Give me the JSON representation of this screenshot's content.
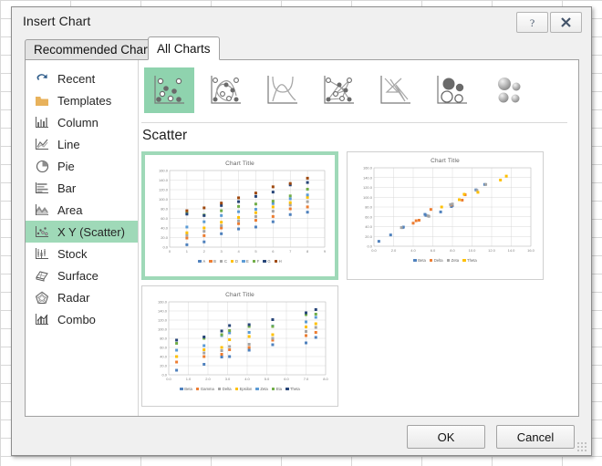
{
  "window": {
    "title": "Insert Chart",
    "help_icon": "question-mark-icon",
    "close_icon": "close-icon"
  },
  "tabs": [
    {
      "label": "Recommended Charts",
      "active": false
    },
    {
      "label": "All Charts",
      "active": true
    }
  ],
  "sidebar": {
    "items": [
      {
        "label": "Recent",
        "icon": "recent-undo-icon",
        "selected": false
      },
      {
        "label": "Templates",
        "icon": "folder-icon",
        "selected": false
      },
      {
        "label": "Column",
        "icon": "column-chart-icon",
        "selected": false
      },
      {
        "label": "Line",
        "icon": "line-chart-icon",
        "selected": false
      },
      {
        "label": "Pie",
        "icon": "pie-chart-icon",
        "selected": false
      },
      {
        "label": "Bar",
        "icon": "bar-chart-icon",
        "selected": false
      },
      {
        "label": "Area",
        "icon": "area-chart-icon",
        "selected": false
      },
      {
        "label": "X Y (Scatter)",
        "icon": "scatter-chart-icon",
        "selected": true
      },
      {
        "label": "Stock",
        "icon": "stock-chart-icon",
        "selected": false
      },
      {
        "label": "Surface",
        "icon": "surface-chart-icon",
        "selected": false
      },
      {
        "label": "Radar",
        "icon": "radar-chart-icon",
        "selected": false
      },
      {
        "label": "Combo",
        "icon": "combo-chart-icon",
        "selected": false
      }
    ]
  },
  "main": {
    "section_title": "Scatter",
    "subtypes": [
      {
        "name": "scatter-markers-only",
        "selected": true
      },
      {
        "name": "scatter-smooth-lines-markers",
        "selected": false
      },
      {
        "name": "scatter-smooth-lines",
        "selected": false
      },
      {
        "name": "scatter-straight-lines-markers",
        "selected": false
      },
      {
        "name": "scatter-straight-lines",
        "selected": false
      },
      {
        "name": "bubble",
        "selected": false
      },
      {
        "name": "bubble-3d",
        "selected": false
      }
    ],
    "selection_color": "#9fd9b8"
  },
  "footer": {
    "ok_label": "OK",
    "cancel_label": "Cancel"
  },
  "chart_data": [
    {
      "id": "preview-1",
      "type": "scatter",
      "title": "Chart Title",
      "selected": true,
      "xlabel": "",
      "ylabel": "",
      "xlim": [
        0,
        9
      ],
      "ylim": [
        0,
        160
      ],
      "xticks": [
        0,
        1,
        2,
        3,
        4,
        5,
        6,
        7,
        8,
        9
      ],
      "yticks": [
        "0.0",
        "20.0",
        "40.0",
        "60.0",
        "80.0",
        "100.0",
        "120.0",
        "140.0",
        "160.0"
      ],
      "grid": true,
      "legend_position": "bottom",
      "series": [
        {
          "name": "A",
          "color": "#4f81bd",
          "points": [
            [
              1,
              5
            ],
            [
              2,
              11
            ],
            [
              3,
              28
            ],
            [
              4,
              38
            ],
            [
              5,
              42
            ],
            [
              6,
              53
            ],
            [
              7,
              68
            ],
            [
              8,
              73
            ]
          ]
        },
        {
          "name": "B",
          "color": "#ed7d31",
          "points": [
            [
              1,
              19
            ],
            [
              2,
              24
            ],
            [
              3,
              40
            ],
            [
              4,
              49
            ],
            [
              5,
              56
            ],
            [
              6,
              64
            ],
            [
              7,
              80
            ],
            [
              8,
              84
            ]
          ]
        },
        {
          "name": "C",
          "color": "#a5a5a5",
          "points": [
            [
              1,
              25
            ],
            [
              2,
              33
            ],
            [
              3,
              45
            ],
            [
              4,
              55
            ],
            [
              5,
              64
            ],
            [
              6,
              75
            ],
            [
              7,
              88
            ],
            [
              8,
              95
            ]
          ]
        },
        {
          "name": "D",
          "color": "#ffc000",
          "points": [
            [
              1,
              30
            ],
            [
              2,
              40
            ],
            [
              3,
              52
            ],
            [
              4,
              62
            ],
            [
              5,
              72
            ],
            [
              6,
              84
            ],
            [
              7,
              93
            ],
            [
              8,
              104
            ]
          ]
        },
        {
          "name": "E",
          "color": "#5b9bd5",
          "points": [
            [
              1,
              42
            ],
            [
              2,
              53
            ],
            [
              3,
              66
            ],
            [
              4,
              74
            ],
            [
              5,
              79
            ],
            [
              6,
              91
            ],
            [
              7,
              101
            ],
            [
              8,
              109
            ]
          ]
        },
        {
          "name": "F",
          "color": "#70ad47",
          "points": [
            [
              1,
              72
            ],
            [
              2,
              67
            ],
            [
              3,
              76
            ],
            [
              4,
              85
            ],
            [
              5,
              90
            ],
            [
              6,
              96
            ],
            [
              7,
              107
            ],
            [
              8,
              121
            ]
          ]
        },
        {
          "name": "G",
          "color": "#264478",
          "points": [
            [
              1,
              69
            ],
            [
              2,
              66
            ],
            [
              3,
              87
            ],
            [
              4,
              95
            ],
            [
              5,
              106
            ],
            [
              6,
              115
            ],
            [
              7,
              130
            ],
            [
              8,
              135
            ]
          ]
        },
        {
          "name": "H",
          "color": "#9e480e",
          "points": [
            [
              1,
              76
            ],
            [
              2,
              82
            ],
            [
              3,
              92
            ],
            [
              4,
              103
            ],
            [
              5,
              113
            ],
            [
              6,
              126
            ],
            [
              7,
              133
            ],
            [
              8,
              144
            ]
          ]
        }
      ]
    },
    {
      "id": "preview-2",
      "type": "scatter",
      "title": "Chart Title",
      "selected": false,
      "xlabel": "",
      "ylabel": "",
      "xlim": [
        0,
        16
      ],
      "ylim": [
        0,
        160
      ],
      "xticks": [
        "0.0",
        "2.0",
        "4.0",
        "6.0",
        "8.0",
        "10.0",
        "12.0",
        "14.0",
        "16.0"
      ],
      "yticks": [
        "0.0",
        "20.0",
        "40.0",
        "60.0",
        "80.0",
        "100.0",
        "120.0",
        "140.0",
        "160.0"
      ],
      "grid": true,
      "legend_position": "bottom",
      "series": [
        {
          "name": "Beta",
          "color": "#4f81bd",
          "points": [
            [
              0.5,
              10
            ],
            [
              1.7,
              23
            ],
            [
              2.9,
              38
            ],
            [
              3.0,
              39
            ],
            [
              5.2,
              65
            ],
            [
              5.3,
              63
            ],
            [
              6.8,
              70
            ],
            [
              7.9,
              81
            ],
            [
              8.0,
              83
            ],
            [
              10.4,
              115
            ],
            [
              11.3,
              126
            ]
          ]
        },
        {
          "name": "Delta",
          "color": "#ed7d31",
          "points": [
            [
              4.0,
              47
            ],
            [
              4.3,
              52
            ],
            [
              4.6,
              53
            ],
            [
              5.8,
              75
            ],
            [
              7.9,
              84
            ],
            [
              9.0,
              94
            ],
            [
              9.3,
              105
            ]
          ]
        },
        {
          "name": "Zeta",
          "color": "#a5a5a5",
          "points": [
            [
              2.8,
              38
            ],
            [
              5.5,
              62
            ],
            [
              5.6,
              61
            ],
            [
              7.8,
              85
            ],
            [
              8.0,
              86
            ],
            [
              10.5,
              114
            ],
            [
              11.4,
              126
            ]
          ]
        },
        {
          "name": "Theta",
          "color": "#ffc000",
          "points": [
            [
              6.9,
              80
            ],
            [
              8.7,
              95
            ],
            [
              9.2,
              106
            ],
            [
              10.6,
              110
            ],
            [
              12.9,
              135
            ],
            [
              13.5,
              143
            ]
          ]
        }
      ]
    },
    {
      "id": "preview-3",
      "type": "scatter",
      "title": "Chart Title",
      "selected": false,
      "xlabel": "",
      "ylabel": "",
      "xlim": [
        0,
        8
      ],
      "ylim": [
        0,
        160
      ],
      "xticks": [
        "0.0",
        "1.0",
        "2.0",
        "3.0",
        "4.0",
        "5.0",
        "6.0",
        "7.0",
        "8.0"
      ],
      "yticks": [
        "0.0",
        "20.0",
        "40.0",
        "60.0",
        "80.0",
        "100.0",
        "120.0",
        "140.0",
        "160.0"
      ],
      "grid": true,
      "legend_position": "bottom",
      "series": [
        {
          "name": "Beta",
          "color": "#4f81bd",
          "points": [
            [
              0.4,
              10
            ],
            [
              1.8,
              23
            ],
            [
              2.7,
              39
            ],
            [
              3.1,
              40
            ],
            [
              4.1,
              54
            ],
            [
              5.3,
              66
            ],
            [
              7.0,
              70
            ],
            [
              7.5,
              82
            ]
          ]
        },
        {
          "name": "Gamma",
          "color": "#ed7d31",
          "points": [
            [
              0.4,
              28
            ],
            [
              1.8,
              40
            ],
            [
              2.7,
              45
            ],
            [
              3.1,
              55
            ],
            [
              4.1,
              60
            ],
            [
              5.3,
              76
            ],
            [
              7.0,
              86
            ],
            [
              7.5,
              93
            ]
          ]
        },
        {
          "name": "Delta",
          "color": "#a5a5a5",
          "points": [
            [
              0.4,
              40
            ],
            [
              1.8,
              48
            ],
            [
              2.7,
              53
            ],
            [
              3.1,
              62
            ],
            [
              4.1,
              67
            ],
            [
              5.3,
              80
            ],
            [
              7.0,
              95
            ],
            [
              7.5,
              104
            ]
          ]
        },
        {
          "name": "Epsilon",
          "color": "#ffc000",
          "points": [
            [
              0.4,
              40
            ],
            [
              1.8,
              55
            ],
            [
              2.7,
              60
            ],
            [
              3.1,
              77
            ],
            [
              4.1,
              84
            ],
            [
              5.3,
              88
            ],
            [
              7.0,
              105
            ],
            [
              7.5,
              112
            ]
          ]
        },
        {
          "name": "Zeta",
          "color": "#5b9bd5",
          "points": [
            [
              0.4,
              54
            ],
            [
              1.8,
              64
            ],
            [
              2.7,
              86
            ],
            [
              3.1,
              92
            ],
            [
              4.1,
              93
            ],
            [
              5.3,
              107
            ],
            [
              7.0,
              116
            ],
            [
              7.5,
              126
            ]
          ]
        },
        {
          "name": "Eta",
          "color": "#70ad47",
          "points": [
            [
              0.4,
              69
            ],
            [
              1.8,
              80
            ],
            [
              2.7,
              88
            ],
            [
              3.1,
              97
            ],
            [
              4.1,
              106
            ],
            [
              5.3,
              106
            ],
            [
              7.0,
              132
            ],
            [
              7.5,
              133
            ]
          ]
        },
        {
          "name": "Theta",
          "color": "#264478",
          "points": [
            [
              0.4,
              76
            ],
            [
              1.8,
              83
            ],
            [
              2.7,
              96
            ],
            [
              3.1,
              108
            ],
            [
              4.1,
              110
            ],
            [
              5.3,
              121
            ],
            [
              7.0,
              136
            ],
            [
              7.5,
              143
            ]
          ]
        }
      ]
    }
  ]
}
